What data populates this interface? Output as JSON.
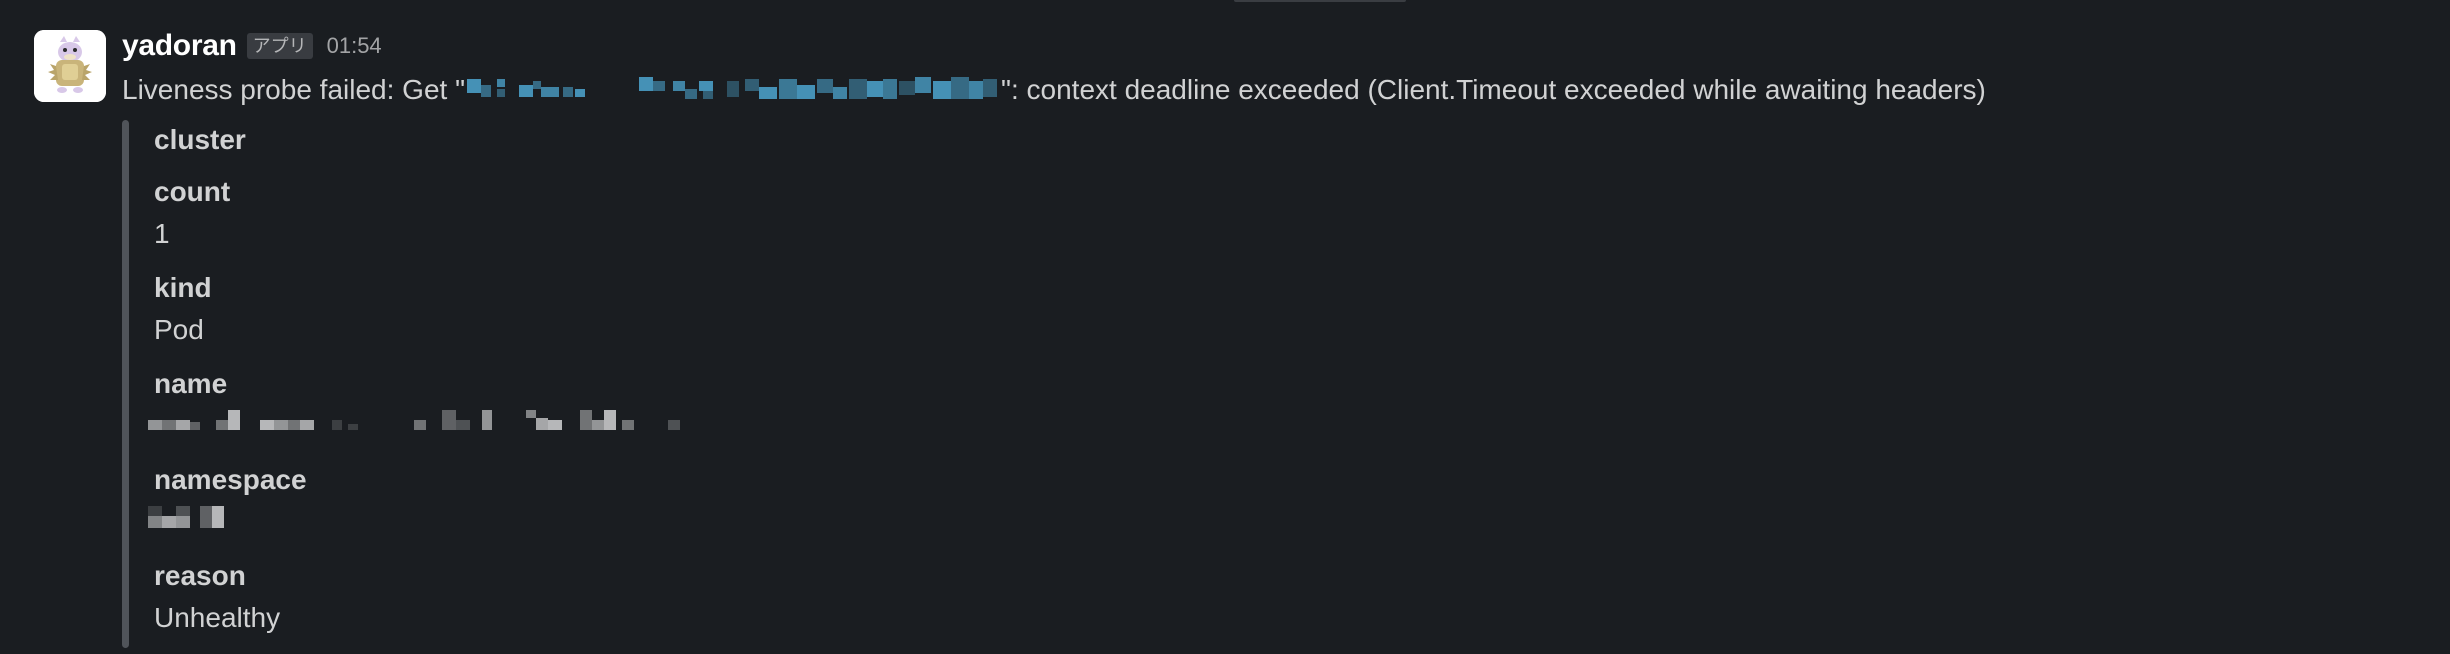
{
  "message": {
    "sender": "yadoran",
    "badge": "アプリ",
    "timestamp": "01:54",
    "text_prefix": "Liveness probe failed: Get \"",
    "text_suffix": "\": context deadline exceeded (Client.Timeout exceeded while awaiting headers)"
  },
  "attachment": {
    "fields": [
      {
        "title": "cluster",
        "value": ""
      },
      {
        "title": "count",
        "value": "1"
      },
      {
        "title": "kind",
        "value": "Pod"
      },
      {
        "title": "name",
        "value": ""
      },
      {
        "title": "namespace",
        "value": ""
      },
      {
        "title": "reason",
        "value": "Unhealthy"
      }
    ]
  },
  "colors": {
    "background": "#1a1d21",
    "text": "#d1d2d3",
    "sender": "#ffffff",
    "attachment_bar": "#50545a",
    "redacted_link": "#4a9fc7"
  },
  "icons": {
    "avatar": "slowpoke-avatar-icon"
  }
}
